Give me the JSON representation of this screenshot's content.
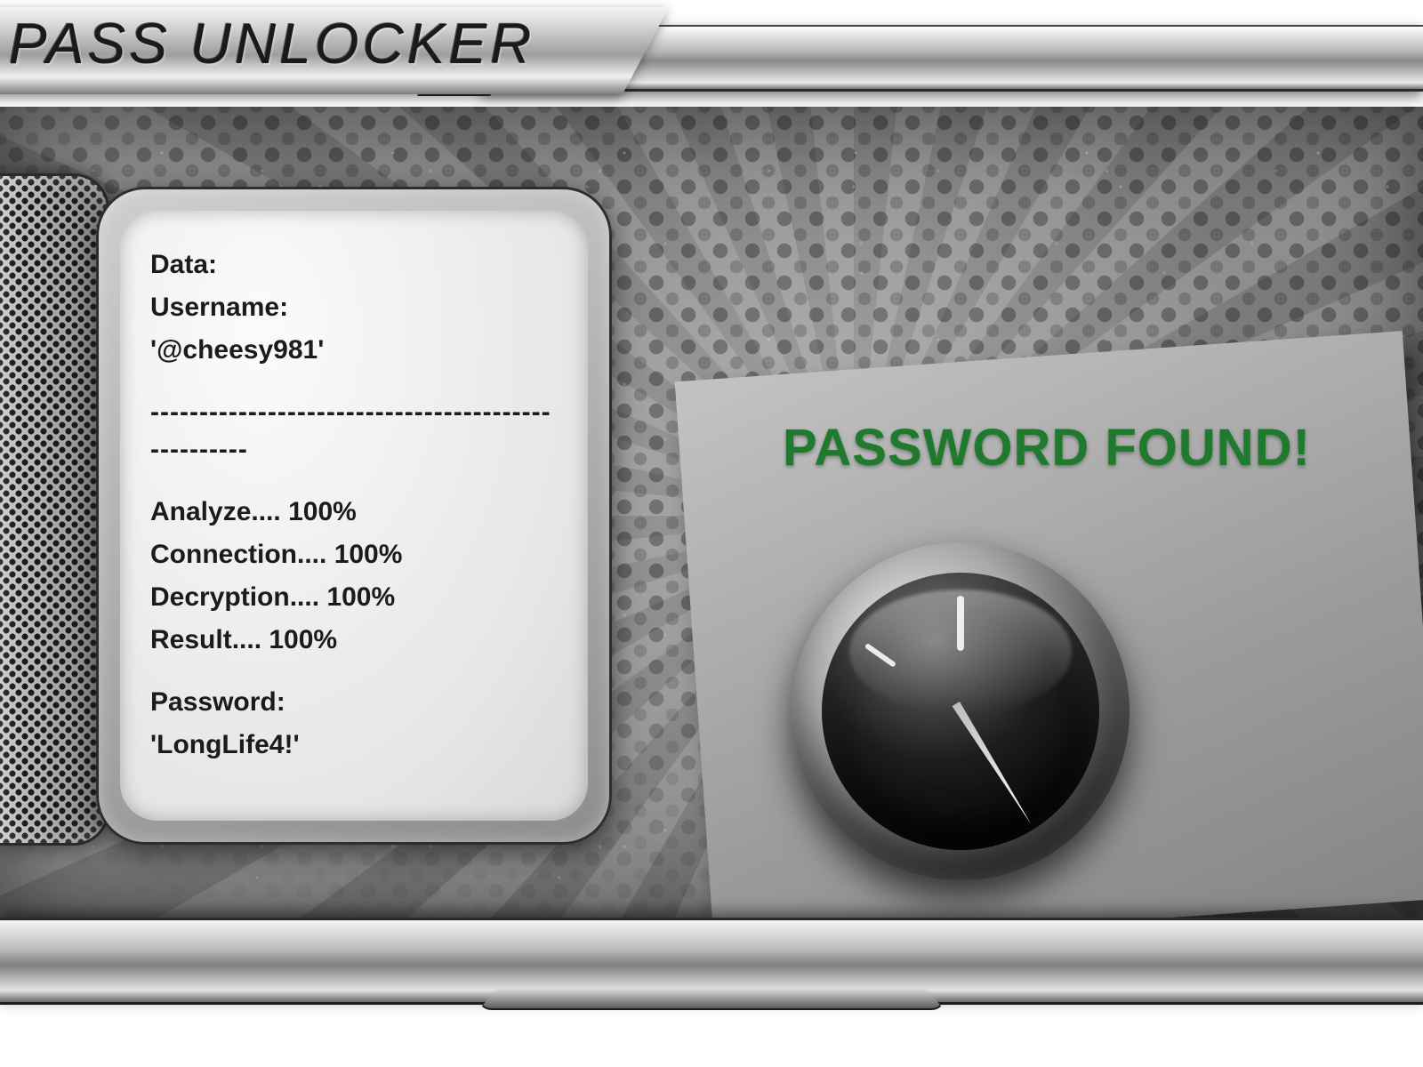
{
  "app_title": "PASS UNLOCKER",
  "panel": {
    "data_label": "Data:",
    "username_label": "Username:",
    "username_value": "'@cheesy981'",
    "divider": "---------------------------------------------------",
    "progress": [
      {
        "label": "Analyze",
        "value": "100%"
      },
      {
        "label": "Connection",
        "value": "100%"
      },
      {
        "label": "Decryption",
        "value": "100%"
      },
      {
        "label": "Result",
        "value": "100%"
      }
    ],
    "password_label": "Password:",
    "password_value": "'LongLife4!'"
  },
  "status_banner": "PASSWORD FOUND!",
  "colors": {
    "status_green": "#1f7a2e"
  }
}
